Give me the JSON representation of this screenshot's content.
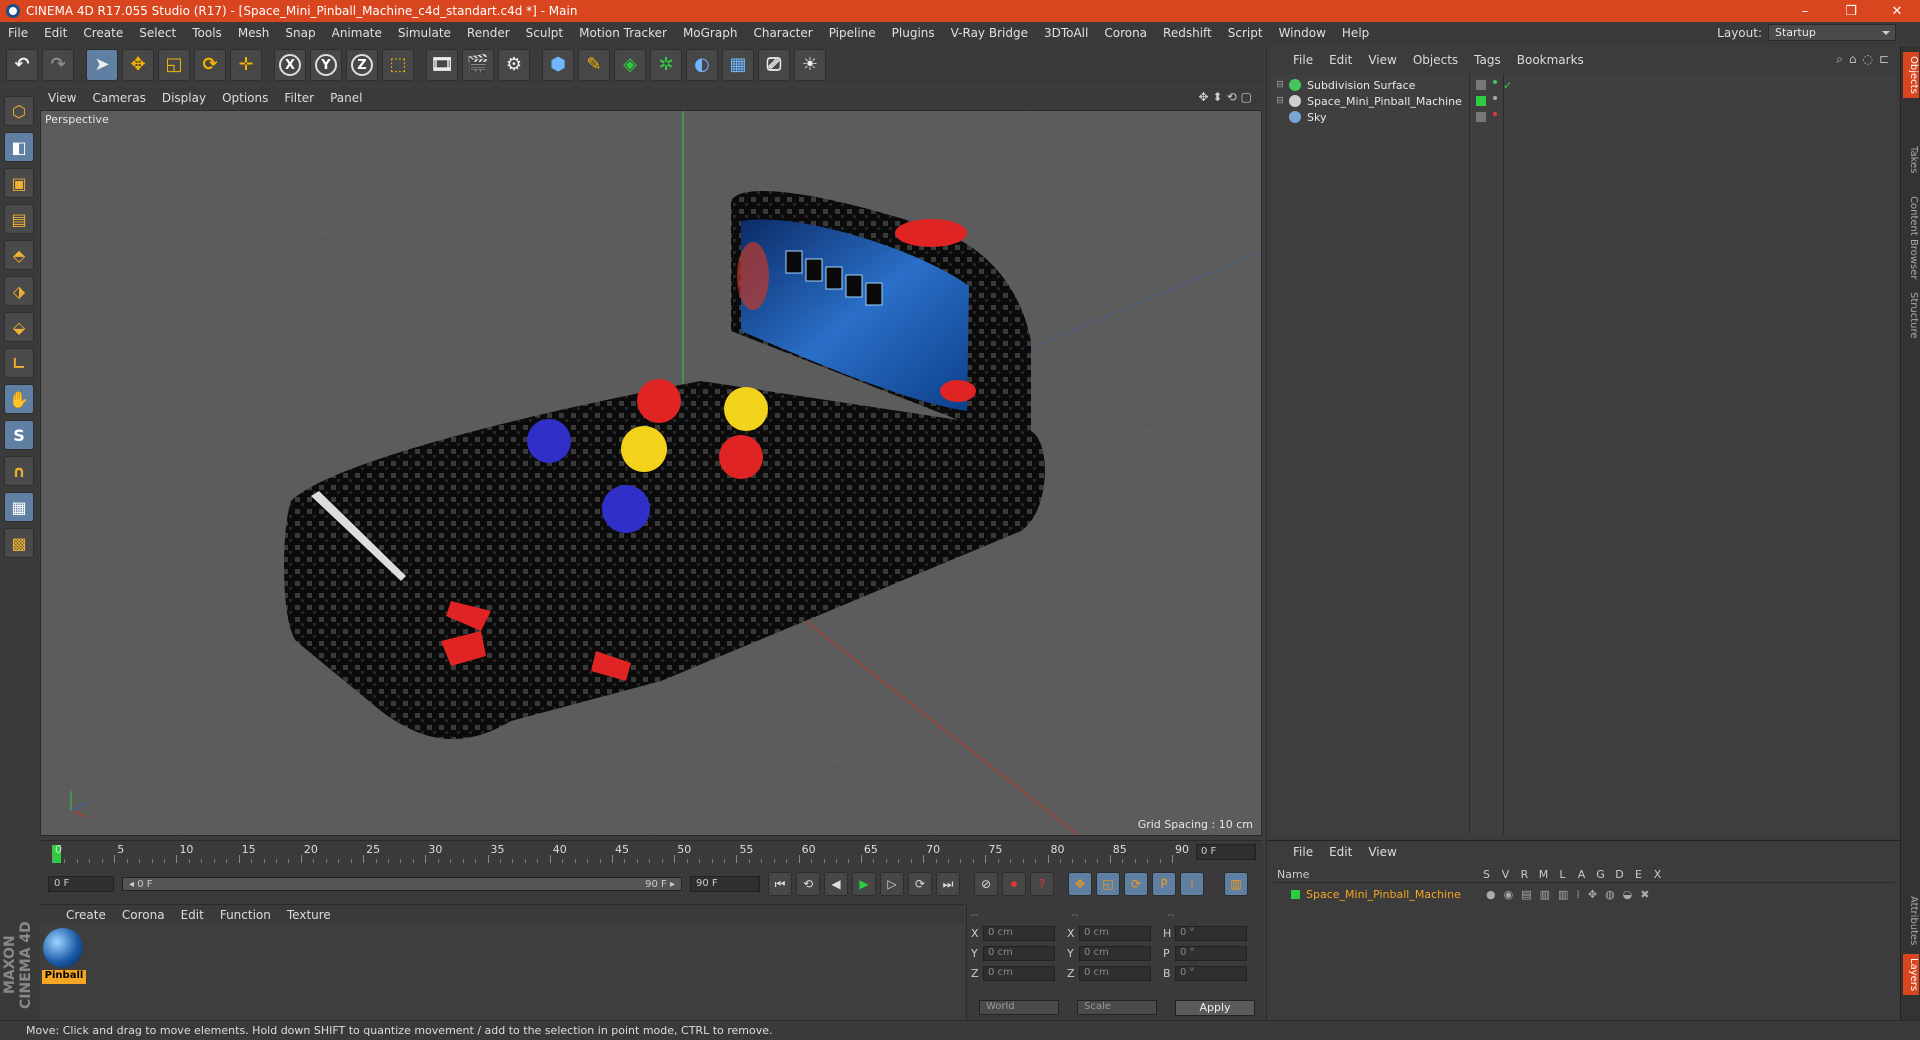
{
  "window": {
    "title": "CINEMA 4D R17.055 Studio (R17) - [Space_Mini_Pinball_Machine_c4d_standart.c4d *] - Main",
    "controls": [
      "–",
      "❐",
      "✕"
    ]
  },
  "menubar": {
    "items": [
      "File",
      "Edit",
      "Create",
      "Select",
      "Tools",
      "Mesh",
      "Snap",
      "Animate",
      "Simulate",
      "Render",
      "Sculpt",
      "Motion Tracker",
      "MoGraph",
      "Character",
      "Pipeline",
      "Plugins",
      "V-Ray Bridge",
      "3DToAll",
      "Corona",
      "Redshift",
      "Script",
      "Window",
      "Help"
    ],
    "layout_label": "Layout:",
    "layout_value": "Startup"
  },
  "toolbar": {
    "icons": [
      "undo-icon",
      "redo-icon",
      "live-selection-icon",
      "move-icon",
      "scale-icon",
      "rotate-icon",
      "last-tool-icon",
      "x-axis-icon",
      "y-axis-icon",
      "z-axis-icon",
      "coordinate-system-icon",
      "render-view-icon",
      "render-picture-viewer-icon",
      "render-settings-icon",
      "cube-icon",
      "pen-icon",
      "subdivision-icon",
      "array-icon",
      "deformer-icon",
      "floor-icon",
      "camera-icon",
      "light-icon"
    ],
    "axis_labels": [
      "X",
      "Y",
      "Z"
    ]
  },
  "viewport": {
    "menu": [
      "View",
      "Cameras",
      "Display",
      "Options",
      "Filter",
      "Panel"
    ],
    "label": "Perspective",
    "grid_spacing": "Grid Spacing : 10 cm"
  },
  "objects_panel": {
    "menu": [
      "File",
      "Edit",
      "View",
      "Objects",
      "Tags",
      "Bookmarks"
    ],
    "rows": [
      {
        "name": "Subdivision Surface",
        "icon_color": "#44c65a",
        "tag_color": "#777777",
        "dot_color": "#44c65a",
        "check": "✓"
      },
      {
        "name": "Space_Mini_Pinball_Machine",
        "icon_color": "#cfcfcf",
        "tag_color": "#2ecc40",
        "dot_color": "#aaaaaa",
        "check": ""
      },
      {
        "name": "Sky",
        "icon_color": "#7aa6d6",
        "tag_color": "#777777",
        "dot_color": "#e33b3b",
        "check": ""
      }
    ]
  },
  "side_tabs": [
    "Objects",
    "Takes",
    "Content Browser",
    "Structure",
    "Attributes",
    "Layers"
  ],
  "timeline": {
    "marks": [
      "0",
      "5",
      "10",
      "15",
      "20",
      "25",
      "30",
      "35",
      "40",
      "45",
      "50",
      "55",
      "60",
      "65",
      "70",
      "75",
      "80",
      "85",
      "90"
    ],
    "current_frame": "0 F"
  },
  "playback": {
    "start_field": "0 F",
    "range_start": "◂ 0 F",
    "range_end": "90 F ▸",
    "end_field": "90 F"
  },
  "material_panel": {
    "menu": [
      "Create",
      "Corona",
      "Edit",
      "Function",
      "Texture"
    ],
    "material_name": "Pinball"
  },
  "coordinates": {
    "header": [
      "--",
      "--",
      "--"
    ],
    "rows": [
      {
        "a": "X",
        "v1": "0 cm",
        "b": "X",
        "v2": "0 cm",
        "c": "H",
        "v3": "0 °"
      },
      {
        "a": "Y",
        "v1": "0 cm",
        "b": "Y",
        "v2": "0 cm",
        "c": "P",
        "v3": "0 °"
      },
      {
        "a": "Z",
        "v1": "0 cm",
        "b": "Z",
        "v2": "0 cm",
        "c": "B",
        "v3": "0 °"
      }
    ],
    "world": "World",
    "scale": "Scale",
    "apply": "Apply"
  },
  "layers_panel": {
    "menu": [
      "File",
      "Edit",
      "View"
    ],
    "name_header": "Name",
    "columns": [
      "S",
      "V",
      "R",
      "M",
      "L",
      "A",
      "G",
      "D",
      "E",
      "X"
    ],
    "row_name": "Space_Mini_Pinball_Machine"
  },
  "status": "Move: Click and drag to move elements. Hold down SHIFT to quantize movement / add to the selection in point mode, CTRL to remove.",
  "brand": "MAXON CINEMA 4D"
}
